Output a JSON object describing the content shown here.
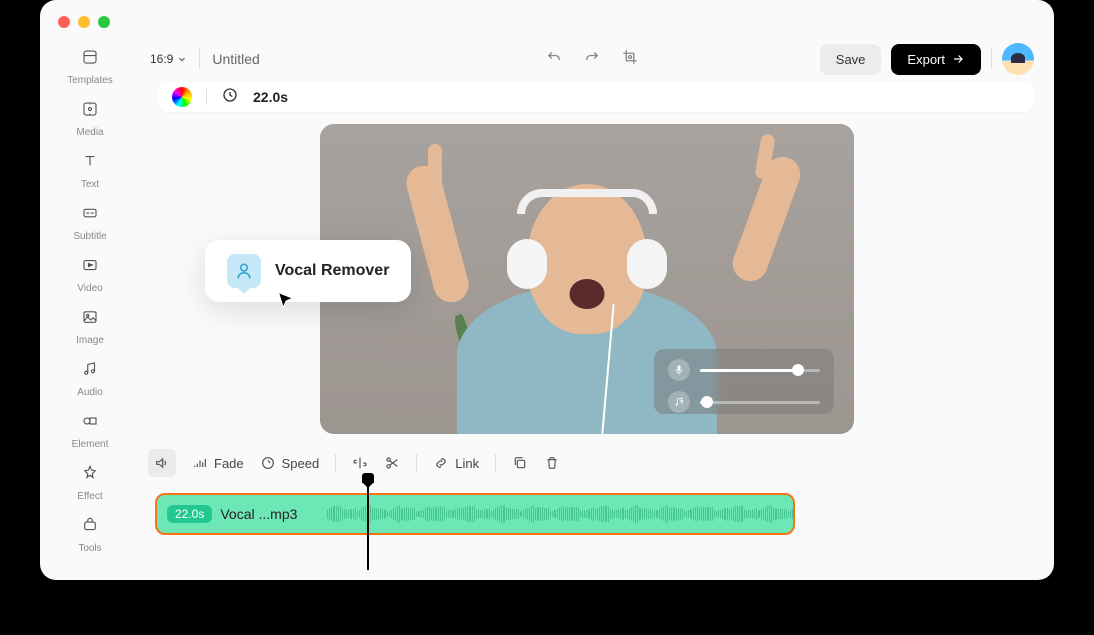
{
  "sidebar": [
    {
      "label": "Templates",
      "icon": "templates"
    },
    {
      "label": "Media",
      "icon": "media"
    },
    {
      "label": "Text",
      "icon": "text"
    },
    {
      "label": "Subtitle",
      "icon": "subtitle"
    },
    {
      "label": "Video",
      "icon": "video"
    },
    {
      "label": "Image",
      "icon": "image"
    },
    {
      "label": "Audio",
      "icon": "audio"
    },
    {
      "label": "Element",
      "icon": "element"
    },
    {
      "label": "Effect",
      "icon": "effect"
    },
    {
      "label": "Tools",
      "icon": "tools"
    }
  ],
  "topbar": {
    "ratio": "16:9",
    "title": "Untitled",
    "save": "Save",
    "export": "Export"
  },
  "infobar": {
    "duration": "22.0s"
  },
  "tooltip": {
    "label": "Vocal Remover"
  },
  "audio_panel": {
    "vocal_level": 82,
    "music_level": 6
  },
  "toolbar": {
    "fade": "Fade",
    "speed": "Speed",
    "link": "Link"
  },
  "timeline": {
    "badge": "22.0s",
    "filename": "Vocal ...mp3"
  }
}
